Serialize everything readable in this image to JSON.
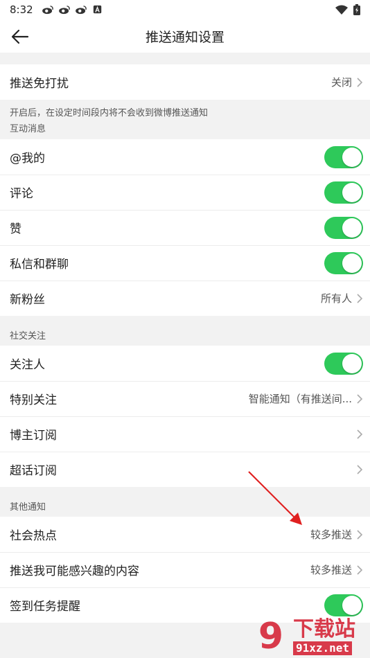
{
  "status_bar": {
    "time": "8:32",
    "left_icons": [
      "weibo-icon",
      "weibo-icon",
      "weibo-icon",
      "text-a-icon"
    ],
    "right_icons": [
      "wifi-icon",
      "battery-icon"
    ]
  },
  "header": {
    "title": "推送通知设置"
  },
  "dnd": {
    "label": "推送免打扰",
    "value": "关闭",
    "note": "开启后，在设定时间段内将不会收到微博推送通知"
  },
  "interaction": {
    "caption": "互动消息",
    "rows": [
      {
        "label": "@我的",
        "type": "toggle",
        "on": true
      },
      {
        "label": "评论",
        "type": "toggle",
        "on": true
      },
      {
        "label": "赞",
        "type": "toggle",
        "on": true
      },
      {
        "label": "私信和群聊",
        "type": "toggle",
        "on": true
      },
      {
        "label": "新粉丝",
        "type": "value",
        "value": "所有人"
      }
    ]
  },
  "social": {
    "caption": "社交关注",
    "rows": [
      {
        "label": "关注人",
        "type": "toggle",
        "on": true
      },
      {
        "label": "特别关注",
        "type": "value",
        "value": "智能通知（有推送间..."
      },
      {
        "label": "博主订阅",
        "type": "chevron"
      },
      {
        "label": "超话订阅",
        "type": "chevron"
      }
    ]
  },
  "other": {
    "caption": "其他通知",
    "rows": [
      {
        "label": "社会热点",
        "type": "value",
        "value": "较多推送"
      },
      {
        "label": "推送我可能感兴趣的内容",
        "type": "value",
        "value": "较多推送"
      },
      {
        "label": "签到任务提醒",
        "type": "toggle",
        "on": true
      }
    ]
  },
  "colors": {
    "toggle_on": "#2ec95a",
    "annotation_arrow": "#e02020",
    "watermark": "#d83a4a"
  },
  "watermark": {
    "glyph": "9",
    "title": "下载站",
    "url": "91xz.net"
  }
}
